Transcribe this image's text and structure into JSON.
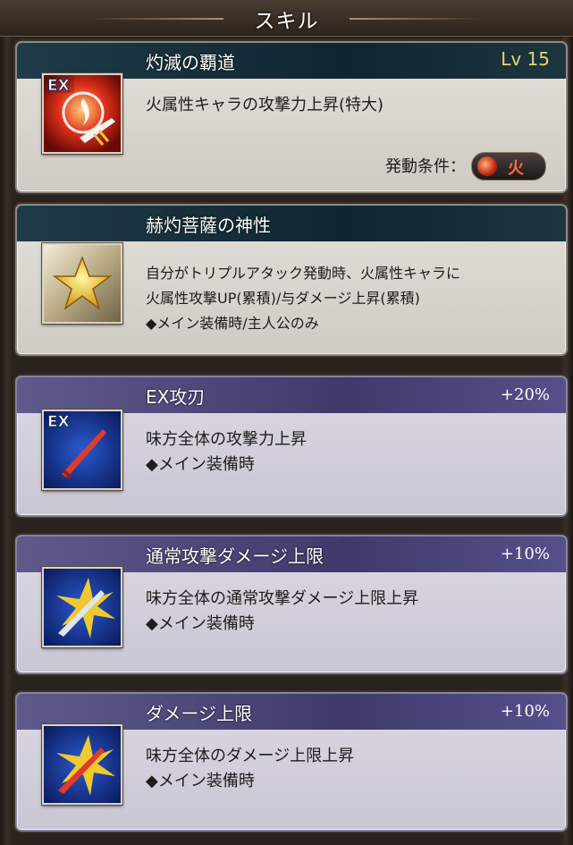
{
  "header": {
    "title": "スキル"
  },
  "skills": [
    {
      "name": "灼滅の覇道",
      "level": "Lv 15",
      "desc": [
        "火属性キャラの攻撃力上昇(特大)"
      ],
      "condition_label": "発動条件：",
      "condition_value": "火",
      "icon": "ex-fire-sword-icon"
    },
    {
      "name": "赫灼菩薩の神性",
      "desc": [
        "自分がトリプルアタック発動時、火属性キャラに",
        "火属性攻撃UP(累積)/与ダメージ上昇(累積)",
        "◆メイン装備時/主人公のみ"
      ],
      "icon": "gold-star-icon"
    },
    {
      "name": "EX攻刃",
      "bonus": "+20%",
      "desc": [
        "味方全体の攻撃力上昇",
        "◆メイン装備時"
      ],
      "icon": "ex-sword-icon"
    },
    {
      "name": "通常攻撃ダメージ上限",
      "bonus": "+10%",
      "desc": [
        "味方全体の通常攻撃ダメージ上限上昇",
        "◆メイン装備時"
      ],
      "icon": "burst-sword-icon"
    },
    {
      "name": "ダメージ上限",
      "bonus": "+10%",
      "desc": [
        "味方全体のダメージ上限上昇",
        "◆メイン装備時"
      ],
      "icon": "burst-red-sword-icon"
    }
  ]
}
